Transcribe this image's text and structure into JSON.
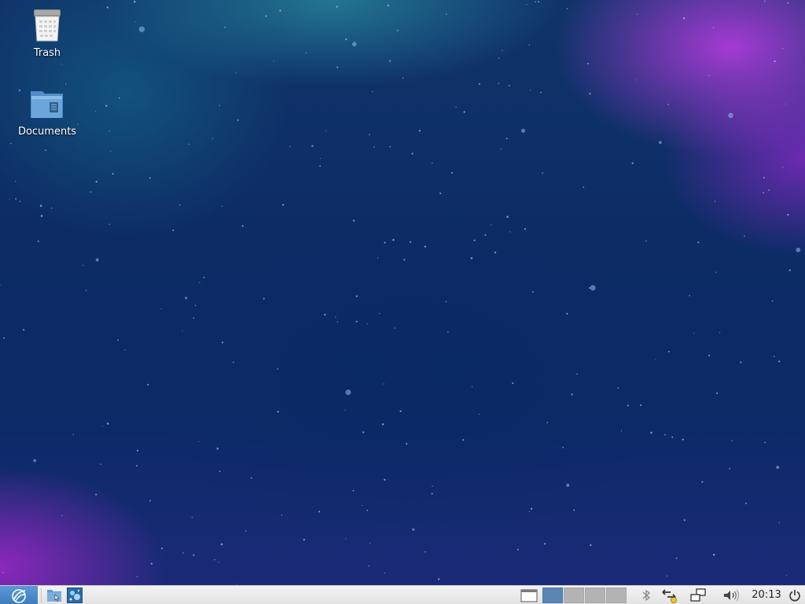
{
  "desktop": {
    "icons": [
      {
        "label": "Trash"
      },
      {
        "label": "Documents"
      }
    ]
  },
  "panel": {
    "menu_icon": "lubuntu-logo-icon",
    "launchers": [
      {
        "icon": "file-manager-icon"
      },
      {
        "icon": "desktop-preferences-icon"
      }
    ],
    "show_desktop_icon": "show-desktop-icon",
    "workspaces": {
      "count": 4,
      "active_index": 0
    },
    "tray": {
      "bluetooth_icon": "bluetooth-icon",
      "network_icon": "network-manager-icon",
      "display_icon": "display-icon",
      "volume_icon": "volume-icon"
    },
    "clock": "20:13",
    "power_icon": "power-icon"
  },
  "colors": {
    "accent": "#4a8ac8",
    "active_workspace": "#5a85b4",
    "panel_bg": "#eaeaea"
  }
}
